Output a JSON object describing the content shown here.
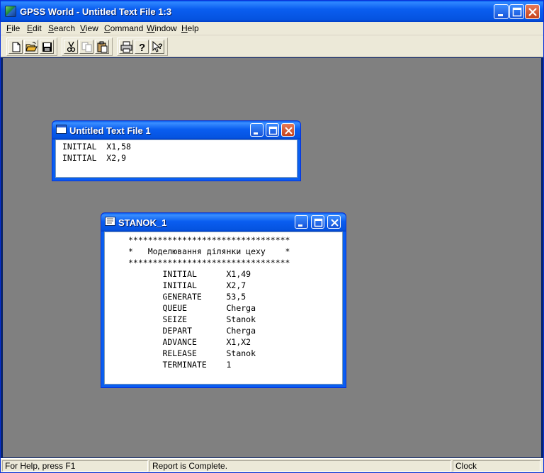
{
  "app": {
    "title": "GPSS World - Untitled Text File 1:3",
    "icon": "gpss-world-icon"
  },
  "menu": {
    "items": [
      {
        "label": "File",
        "ul": "F",
        "rest": "ile"
      },
      {
        "label": "Edit",
        "ul": "E",
        "rest": "dit"
      },
      {
        "label": "Search",
        "ul": "S",
        "rest": "earch"
      },
      {
        "label": "View",
        "ul": "V",
        "rest": "iew"
      },
      {
        "label": "Command",
        "ul": "C",
        "rest": "ommand"
      },
      {
        "label": "Window",
        "ul": "W",
        "rest": "indow"
      },
      {
        "label": "Help",
        "ul": "H",
        "rest": "elp"
      }
    ]
  },
  "toolbar": {
    "buttons": [
      "new-file-icon",
      "open-folder-icon",
      "save-disk-icon",
      "cut-scissors-icon",
      "copy-icon",
      "paste-clipboard-icon",
      "print-icon",
      "help-question-icon",
      "context-help-icon"
    ]
  },
  "windows": {
    "text_file": {
      "title": "Untitled Text File 1",
      "lines": [
        "INITIAL  X1,58",
        "INITIAL  X2,9"
      ]
    },
    "stanok": {
      "title": "STANOK_1",
      "lines": [
        "*********************************",
        "*   Моделювання ділянки цеху    *",
        "*********************************",
        "       INITIAL      X1,49",
        "       INITIAL      X2,7",
        "       GENERATE     53,5",
        "       QUEUE        Cherga",
        "       SEIZE        Stanok",
        "       DEPART       Cherga",
        "       ADVANCE      X1,X2",
        "       RELEASE      Stanok",
        "       TERMINATE    1"
      ]
    }
  },
  "status": {
    "help": "For Help, press F1",
    "report": "Report is Complete.",
    "clock": "Clock"
  },
  "colors": {
    "titlebar": "#0a5ef0",
    "mdi_background": "#808080",
    "chrome": "#ece9d8",
    "close_button": "#d2502a"
  }
}
